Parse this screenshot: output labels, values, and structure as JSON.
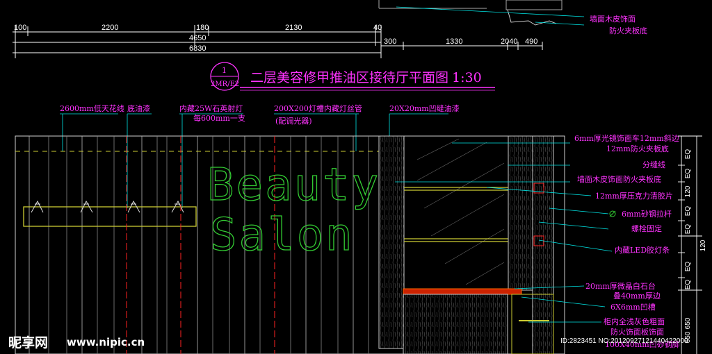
{
  "drawing": {
    "top_dims": [
      "100",
      "2200",
      "180",
      "2130",
      "40"
    ],
    "top_total_1": "4650",
    "top_total_2": "6830",
    "right_dims": [
      "300",
      "1330",
      "2040",
      "490"
    ],
    "top_right_notes": [
      "墙面木皮饰面",
      "防火夹板底"
    ],
    "title": "二层美容修甲推油区接待厅平面图",
    "scale": "1:30",
    "badge_number": "1",
    "badge_code": "2MR/E2",
    "upper_notes": [
      "2600mm低天花线",
      "底油漆",
      "内藏25W石英射灯",
      "每600mm一支",
      "200X200灯槽内藏灯丝管",
      "(配调光器)",
      "20X20mm凹缝油漆"
    ],
    "right_notes": [
      "6mm厚光镜饰面车12mm斜边",
      "12mm防火夹板底",
      "分缝线",
      "墙面木皮饰面防火夹板底",
      "12mm厚压克力清胶片",
      "6mm砂钢拉杆",
      "螺栓固定",
      "内藏LED胶灯条",
      "20mm厚微晶白石台",
      "叠40mm厚边",
      "6X6mm凹槽",
      "柜内全浅灰色粗面",
      "防火饰面板饰面",
      "100X40mm凹砂钢脚"
    ],
    "vertical_dims": [
      "EQ",
      "EQ",
      "120",
      "EQ",
      "EQ",
      "120",
      "EQ",
      "EQ",
      "650",
      "650"
    ],
    "sign_text": [
      "Beauty",
      "Salon"
    ]
  },
  "watermark": {
    "logo": "昵享网",
    "url": "www.nipic.cn",
    "id": "ID:2823451 NO:20120927121440422000"
  },
  "colors": {
    "annotation": "#ff33ff",
    "dimension": "#ffffff",
    "leader": "#00e5e5",
    "sign": "#33cc33",
    "accent": "#ff2222",
    "background": "#000000"
  }
}
